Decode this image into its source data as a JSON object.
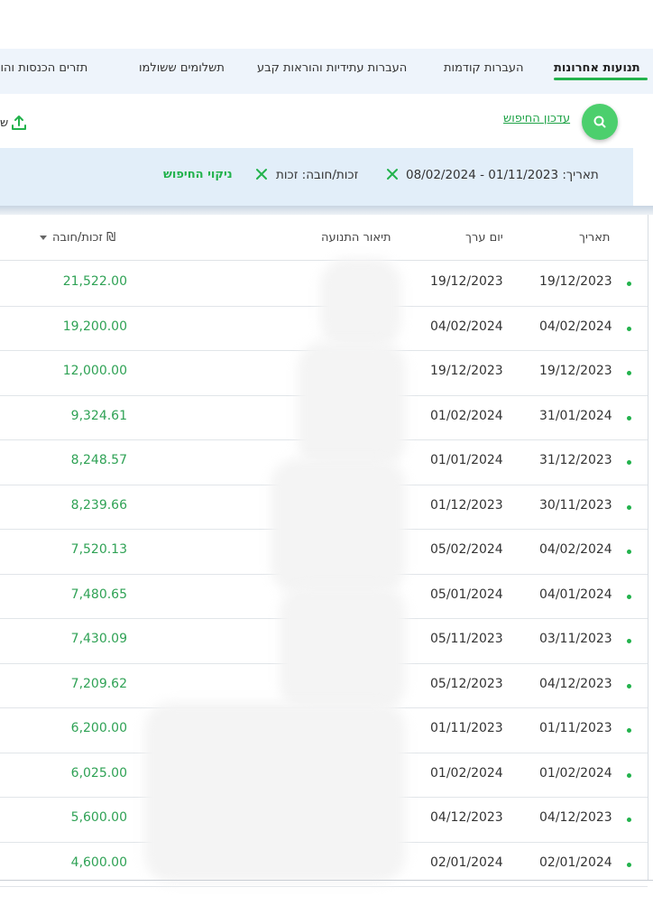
{
  "tabs": [
    {
      "label": "תנועות אחרונות",
      "active": true
    },
    {
      "label": "העברות קודמות",
      "active": false
    },
    {
      "label": "העברות עתידיות והוראות קבע",
      "active": false
    },
    {
      "label": "תשלומים ששולמו",
      "active": false
    },
    {
      "label": "תזרים הכנסות והוצאות",
      "active": false
    }
  ],
  "search": {
    "update_label": "עדכון החיפוש",
    "export_label": "ש"
  },
  "filters": {
    "date_label": "תאריך: 01/11/2023 - 08/02/2024",
    "type_label": "זכות/חובה: זכות",
    "clear_label": "ניקוי החיפוש"
  },
  "table": {
    "headers": {
      "date": "תאריך",
      "value_date": "יום ערך",
      "description": "תיאור התנועה",
      "amount": "זכות/חובה ₪"
    },
    "rows": [
      {
        "date": "19/12/2023",
        "value_date": "19/12/2023",
        "amount": "21,522.00"
      },
      {
        "date": "04/02/2024",
        "value_date": "04/02/2024",
        "amount": "19,200.00"
      },
      {
        "date": "19/12/2023",
        "value_date": "19/12/2023",
        "amount": "12,000.00"
      },
      {
        "date": "31/01/2024",
        "value_date": "01/02/2024",
        "amount": "9,324.61"
      },
      {
        "date": "31/12/2023",
        "value_date": "01/01/2024",
        "amount": "8,248.57"
      },
      {
        "date": "30/11/2023",
        "value_date": "01/12/2023",
        "amount": "8,239.66"
      },
      {
        "date": "04/02/2024",
        "value_date": "05/02/2024",
        "amount": "7,520.13"
      },
      {
        "date": "04/01/2024",
        "value_date": "05/01/2024",
        "amount": "7,480.65"
      },
      {
        "date": "03/11/2023",
        "value_date": "05/11/2023",
        "amount": "7,430.09"
      },
      {
        "date": "04/12/2023",
        "value_date": "05/12/2023",
        "amount": "7,209.62"
      },
      {
        "date": "01/11/2023",
        "value_date": "01/11/2023",
        "amount": "6,200.00"
      },
      {
        "date": "01/02/2024",
        "value_date": "01/02/2024",
        "amount": "6,025.00"
      },
      {
        "date": "04/12/2023",
        "value_date": "04/12/2023",
        "amount": "5,600.00"
      },
      {
        "date": "02/01/2024",
        "value_date": "02/01/2024",
        "amount": "4,600.00"
      }
    ]
  },
  "colors": {
    "accent": "#22b24c",
    "amount": "#2fa255",
    "panel": "#e2eef9"
  }
}
